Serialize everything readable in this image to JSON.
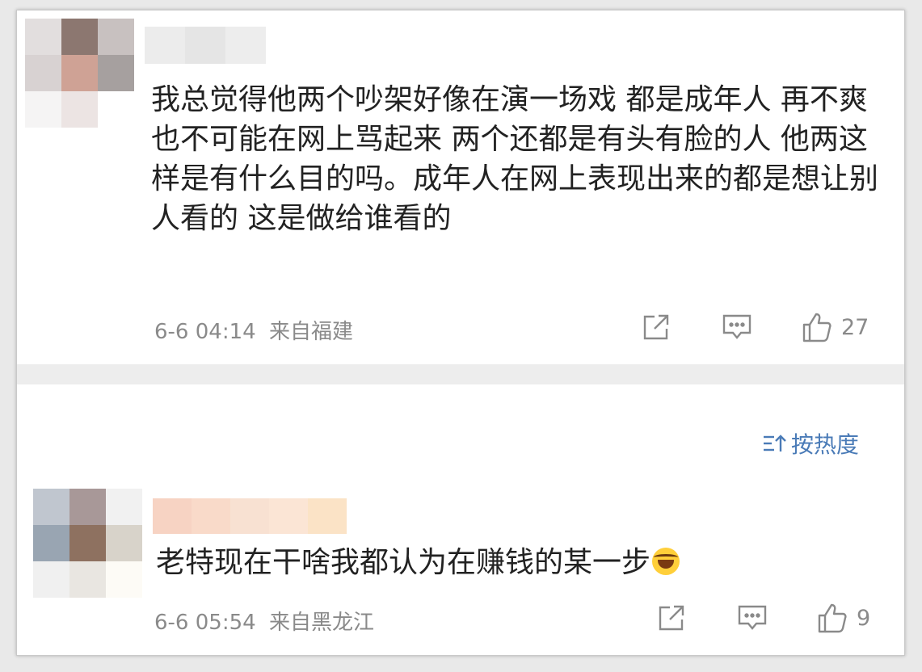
{
  "comments": [
    {
      "text": "我总觉得他两个吵架好像在演一场戏  都是成年人  再不爽也不可能在网上骂起来 两个还都是有头有脸的人 他两这样是有什么目的吗。成年人在网上表现出来的都是想让别人看的 这是做给谁看的",
      "time": "6-6 04:14",
      "location": "来自福建",
      "likes": "27",
      "icons": [
        "share-icon",
        "comment-icon",
        "thumbs-up-icon"
      ]
    },
    {
      "text": "老特现在干啥我都认为在赚钱的某一步",
      "emoji": "laughing-crying-emoji",
      "time": "6-6 05:54",
      "location": "来自黑龙江",
      "likes": "9",
      "icons": [
        "share-icon",
        "comment-icon",
        "thumbs-up-icon"
      ]
    }
  ],
  "sort": {
    "label": "按热度",
    "icon": "sort-icon"
  },
  "colors": {
    "text": "#222222",
    "meta": "#8a8a8a",
    "link": "#4a7bb7",
    "divider": "#ededed"
  }
}
